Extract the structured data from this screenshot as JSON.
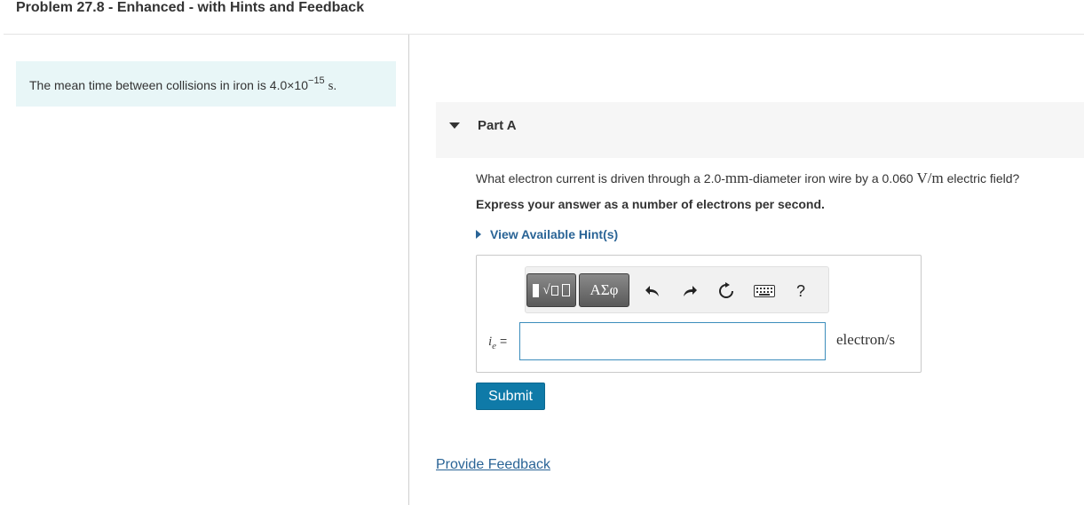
{
  "header": {
    "title": "Problem 27.8 - Enhanced - with Hints and Feedback"
  },
  "intro": {
    "text_before": "The mean time between collisions in iron is 4.0×10",
    "exponent": "−15",
    "unit": "s",
    "text_after": "."
  },
  "part": {
    "label": "Part A"
  },
  "question": {
    "prefix": "What electron current is driven through a 2.0-",
    "mm": "mm",
    "middle": "-diameter iron wire by a 0.060 ",
    "field_unit": "V/m",
    "suffix": " electric field?"
  },
  "instruction": "Express your answer as a number of electrons per second.",
  "hints_link": "View Available Hint(s)",
  "toolbar": {
    "greek_label": "ΑΣφ",
    "help_label": "?",
    "icons": [
      "templates-icon",
      "greek-letters-icon",
      "undo-icon",
      "redo-icon",
      "reset-icon",
      "keyboard-icon",
      "help-icon"
    ]
  },
  "answer": {
    "var_symbol": "i",
    "var_subscript": "e",
    "equals": "=",
    "value": "",
    "unit": "electron/s"
  },
  "submit_label": "Submit",
  "feedback_link": "Provide Feedback",
  "colors": {
    "accent": "#0f7aa8",
    "link": "#2a6496",
    "intro_bg": "#e8f6f7"
  }
}
